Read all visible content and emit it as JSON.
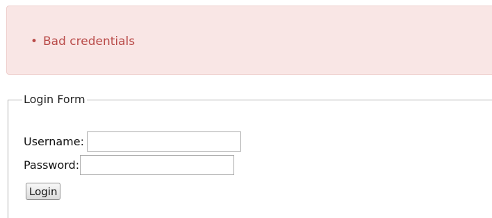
{
  "alert": {
    "messages": [
      "Bad credentials"
    ]
  },
  "login_form": {
    "legend": "Login Form",
    "username_label": "Username:",
    "username_value": "",
    "password_label": "Password:",
    "password_value": "",
    "submit_label": "Login"
  },
  "colors": {
    "alert_background": "#f9e6e5",
    "alert_border": "#efcfcd",
    "alert_text": "#b94a48"
  }
}
